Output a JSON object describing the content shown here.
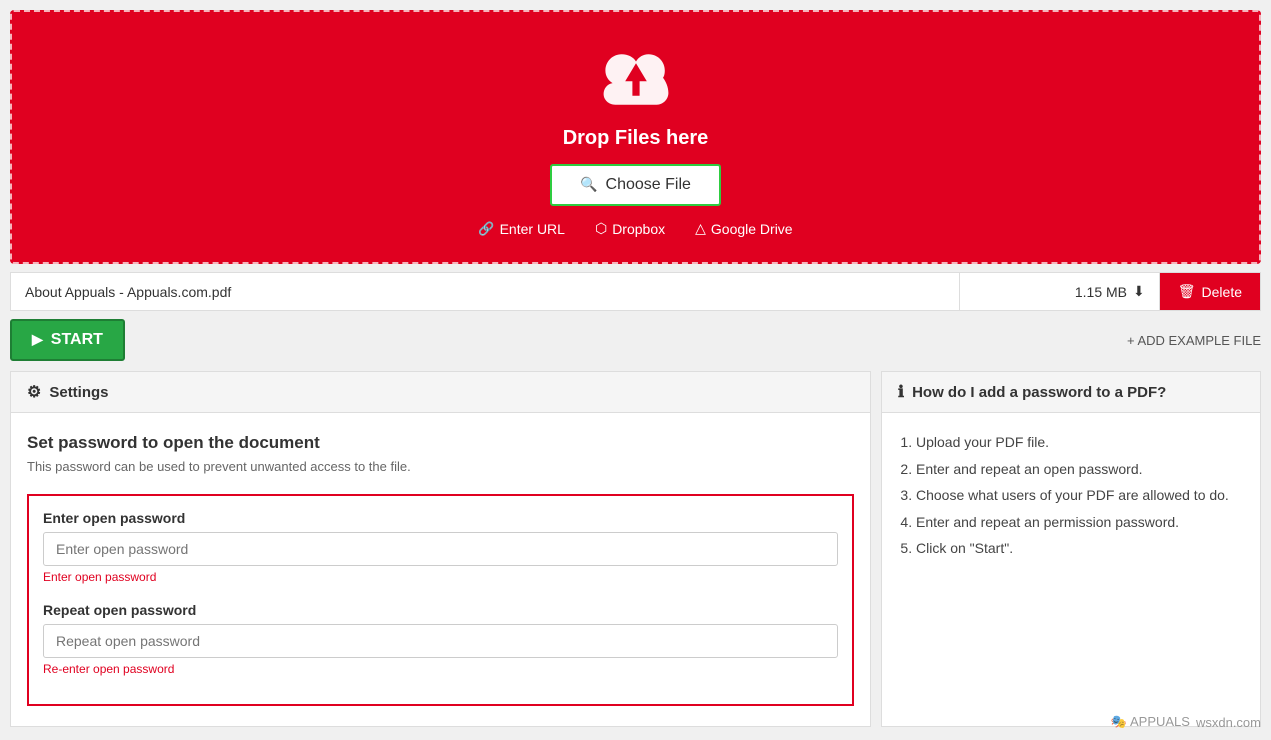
{
  "dropzone": {
    "drop_text": "Drop Files here",
    "choose_file_label": "Choose File",
    "source_links": [
      {
        "id": "enter-url",
        "label": "Enter URL",
        "icon": "link-icon"
      },
      {
        "id": "dropbox",
        "label": "Dropbox",
        "icon": "dropbox-icon"
      },
      {
        "id": "google-drive",
        "label": "Google Drive",
        "icon": "gdrive-icon"
      }
    ]
  },
  "file_row": {
    "file_name": "About Appuals - Appuals.com.pdf",
    "file_size": "1.15 MB",
    "delete_label": "Delete"
  },
  "actions": {
    "start_label": "START",
    "add_example_label": "+ ADD EXAMPLE FILE"
  },
  "settings": {
    "header_label": "Settings",
    "title": "Set password to open the document",
    "description": "This password can be used to prevent unwanted access to the file.",
    "open_password": {
      "label": "Enter open password",
      "placeholder": "Enter open password",
      "error": "Enter open password"
    },
    "repeat_password": {
      "label": "Repeat open password",
      "placeholder": "Repeat open password",
      "error": "Re-enter open password"
    }
  },
  "info": {
    "header_label": "How do I add a password to a PDF?",
    "steps": [
      "Upload your PDF file.",
      "Enter and repeat an open password.",
      "Choose what users of your PDF are allowed to do.",
      "Enter and repeat an permission password.",
      "Click on \"Start\"."
    ]
  },
  "watermark": {
    "site": "wsxdn.com"
  }
}
